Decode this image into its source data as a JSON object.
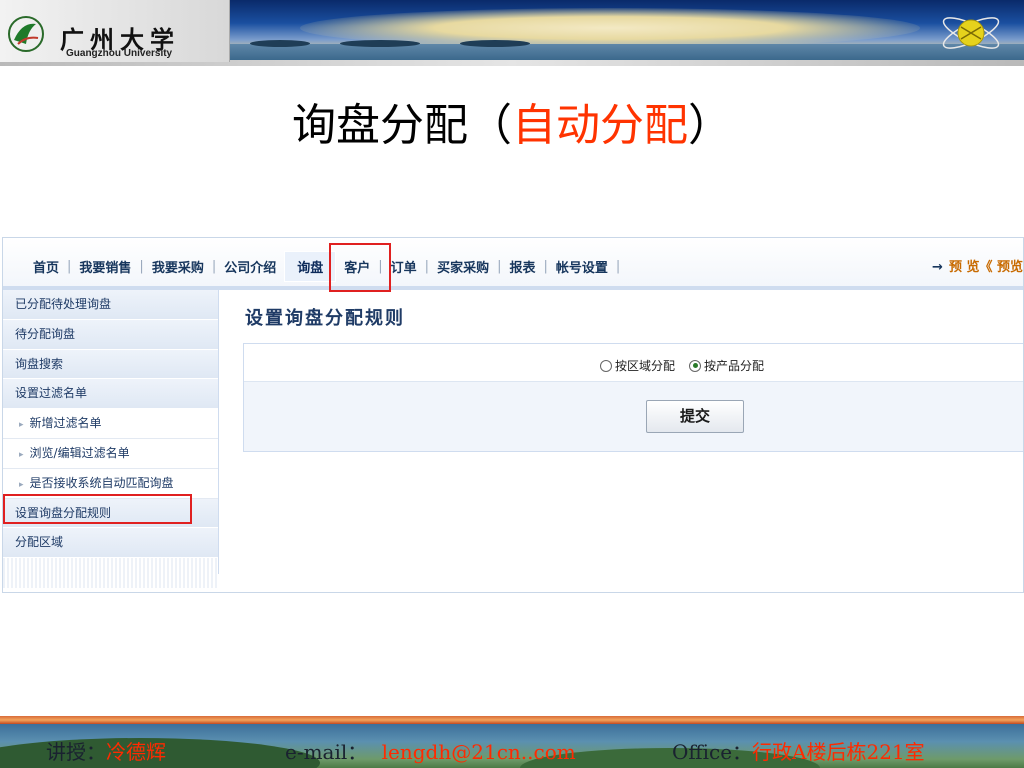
{
  "header": {
    "logo_cn": "广州大学",
    "logo_en": "Guangzhou University"
  },
  "slide": {
    "title_main": "询盘分配（",
    "title_accent": "自动分配",
    "title_close": "）",
    "accent_color": "#ff3300"
  },
  "navbar": {
    "items": [
      "首页",
      "我要销售",
      "我要采购",
      "公司介绍",
      "询盘",
      "客户",
      "订单",
      "买家采购",
      "报表",
      "帐号设置"
    ],
    "active_item": "询盘",
    "preview_label": "预 览《 预览"
  },
  "sidebar": {
    "items": [
      {
        "label": "已分配待处理询盘",
        "type": "head"
      },
      {
        "label": "待分配询盘",
        "type": "head"
      },
      {
        "label": "询盘搜索",
        "type": "head"
      },
      {
        "label": "设置过滤名单",
        "type": "head"
      },
      {
        "label": "新增过滤名单",
        "type": "sub"
      },
      {
        "label": "浏览/编辑过滤名单",
        "type": "sub"
      },
      {
        "label": "是否接收系统自动匹配询盘",
        "type": "sub"
      },
      {
        "label": "设置询盘分配规则",
        "type": "head"
      },
      {
        "label": "分配区域",
        "type": "head"
      }
    ]
  },
  "main": {
    "section_title": "设置询盘分配规则",
    "radio_options": [
      {
        "label": "按区域分配",
        "checked": false
      },
      {
        "label": "按产品分配",
        "checked": true
      }
    ],
    "submit_label": "提交"
  },
  "footer": {
    "lecturer_label": "讲授：",
    "lecturer_name": "冷德辉",
    "email_label": "e-mail：",
    "email_value": "lengdh@21cn..com",
    "office_label": "Office：",
    "office_value": "行政A楼后栋221室"
  }
}
